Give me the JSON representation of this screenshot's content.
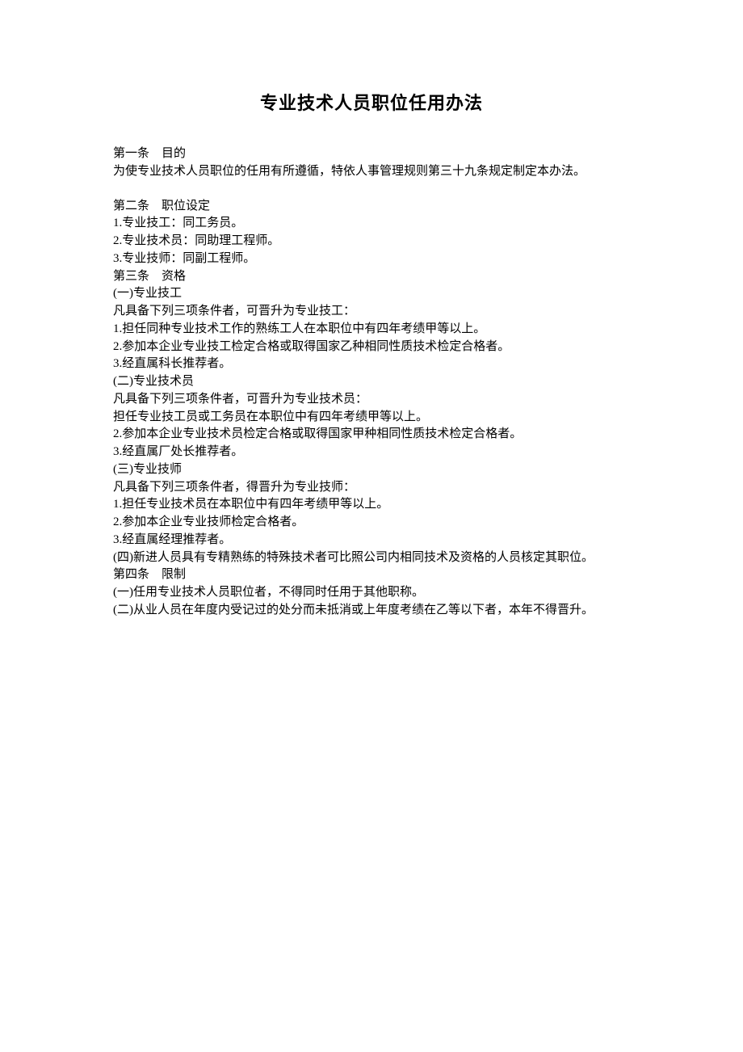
{
  "title": "专业技术人员职位任用办法",
  "lines": [
    {
      "text": "第一条　目的",
      "indent": true
    },
    {
      "text": "为使专业技术人员职位的任用有所遵循，特依人事管理规则第三十九条规定制定本办法。",
      "indent": true
    },
    {
      "text": "",
      "blank": true
    },
    {
      "text": "第二条　职位设定",
      "indent": true
    },
    {
      "text": "1.专业技工：同工务员。",
      "indent": true
    },
    {
      "text": "2.专业技术员：同助理工程师。",
      "indent": true
    },
    {
      "text": "3.专业技师：同副工程师。",
      "indent": true
    },
    {
      "text": "第三条　资格",
      "indent": true
    },
    {
      "text": "(一)专业技工",
      "indent": true
    },
    {
      "text": "凡具备下列三项条件者，可晋升为专业技工：",
      "indent": true
    },
    {
      "text": "1.担任同种专业技术工作的熟练工人在本职位中有四年考绩甲等以上。",
      "indent": true
    },
    {
      "text": "2.参加本企业专业技工检定合格或取得国家乙种相同性质技术检定合格者。",
      "indent": true
    },
    {
      "text": "3.经直属科长推荐者。",
      "indent": true
    },
    {
      "text": "(二)专业技术员",
      "indent": true
    },
    {
      "text": "凡具备下列三项条件者，可晋升为专业技术员：",
      "indent": true
    },
    {
      "text": "担任专业技工员或工务员在本职位中有四年考绩甲等以上。",
      "indent": true
    },
    {
      "text": "2.参加本企业专业技术员检定合格或取得国家甲种相同性质技术检定合格者。",
      "indent": true
    },
    {
      "text": "3.经直属厂处长推荐者。",
      "indent": true
    },
    {
      "text": "(三)专业技师",
      "indent": true
    },
    {
      "text": "凡具备下列三项条件者，得晋升为专业技师：",
      "indent": true
    },
    {
      "text": "1.担任专业技术员在本职位中有四年考绩甲等以上。",
      "indent": true
    },
    {
      "text": "2.参加本企业专业技师检定合格者。",
      "indent": true
    },
    {
      "text": "3.经直属经理推荐者。",
      "indent": true
    },
    {
      "text": "(四)新进人员具有专精熟练的特殊技术者可比照公司内相同技术及资格的人员核定其职位。",
      "indent": true,
      "hang": true
    },
    {
      "text": "第四条　限制",
      "indent": true
    },
    {
      "text": "(一)任用专业技术人员职位者，不得同时任用于其他职称。",
      "indent": true
    },
    {
      "text": "(二)从业人员在年度内受记过的处分而未抵消或上年度考绩在乙等以下者，本年不得晋升。",
      "indent": true,
      "hang": true
    }
  ]
}
